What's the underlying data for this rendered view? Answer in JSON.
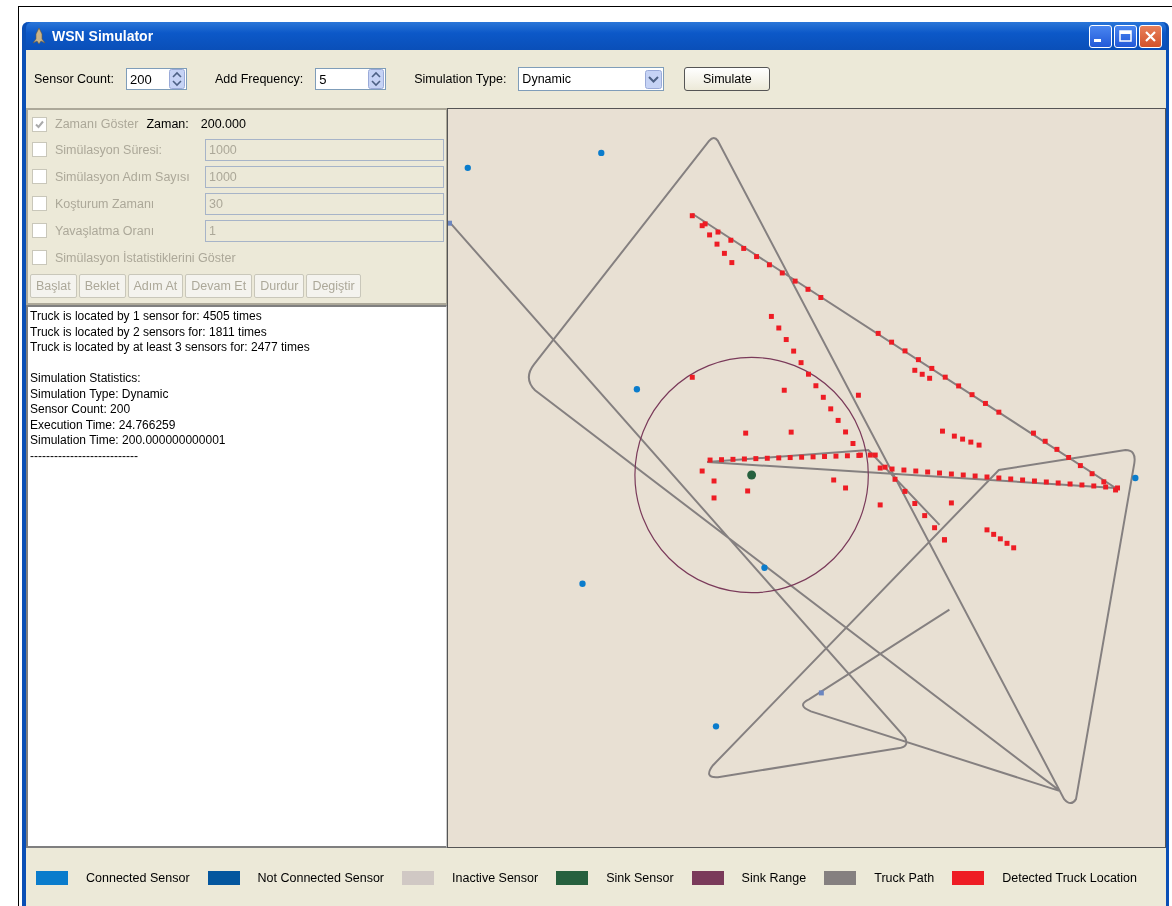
{
  "window": {
    "title": "WSN Simulator"
  },
  "toolbar": {
    "sensor_count": {
      "label": "Sensor Count:",
      "value": "200"
    },
    "add_frequency": {
      "label": "Add Frequency:",
      "value": "5"
    },
    "simulation_type": {
      "label": "Simulation Type:",
      "value": "Dynamic"
    },
    "simulate_button": "Simulate"
  },
  "options": [
    {
      "kind": "readout",
      "label": "Zamanı Göster",
      "checked": true,
      "disabled": true,
      "readout_label": "Zaman:",
      "readout_value": "200.000"
    },
    {
      "kind": "field",
      "label": "Simülasyon Süresi:",
      "checked": false,
      "disabled": true,
      "value": "1000"
    },
    {
      "kind": "field",
      "label": "Simülasyon Adım Sayısı",
      "checked": false,
      "disabled": true,
      "value": "1000"
    },
    {
      "kind": "field",
      "label": "Koşturum Zamanı",
      "checked": false,
      "disabled": true,
      "value": "30"
    },
    {
      "kind": "field",
      "label": "Yavaşlatma Oranı",
      "checked": false,
      "disabled": true,
      "value": "1"
    },
    {
      "kind": "plain",
      "label": "Simülasyon İstatistiklerini Göster",
      "checked": false,
      "disabled": true
    }
  ],
  "control_buttons": [
    {
      "label": "Başlat",
      "disabled": true
    },
    {
      "label": "Beklet",
      "disabled": true
    },
    {
      "label": "Adım At",
      "disabled": true
    },
    {
      "label": "Devam Et",
      "disabled": true
    },
    {
      "label": "Durdur",
      "disabled": true
    },
    {
      "label": "Degiştir",
      "disabled": true
    }
  ],
  "log": [
    [
      "Truck is located by 1 sensor for: 4505 times",
      "Truck is located by 2 sensors for: 1811 times",
      "Truck is located by at least 3 sensors for: 2477 times"
    ],
    [
      "Simulation Statistics:",
      "Simulation Type: Dynamic",
      "Sensor Count: 200",
      "Execution Time: 24.766259",
      "Simulation Time: 200.000000000001",
      "---------------------------"
    ]
  ],
  "legend": [
    {
      "label": "Connected Sensor",
      "color": "#0a7ccc"
    },
    {
      "label": "Not Connected Sensor",
      "color": "#04569e"
    },
    {
      "label": "Inactive Sensor",
      "color": "#d0c8c4"
    },
    {
      "label": "Sink Sensor",
      "color": "#26603e"
    },
    {
      "label": "Sink Range",
      "color": "#7a3a5a"
    },
    {
      "label": "Truck Path",
      "color": "#858080"
    },
    {
      "label": "Detected Truck Location",
      "color": "#ee1c24"
    }
  ]
}
